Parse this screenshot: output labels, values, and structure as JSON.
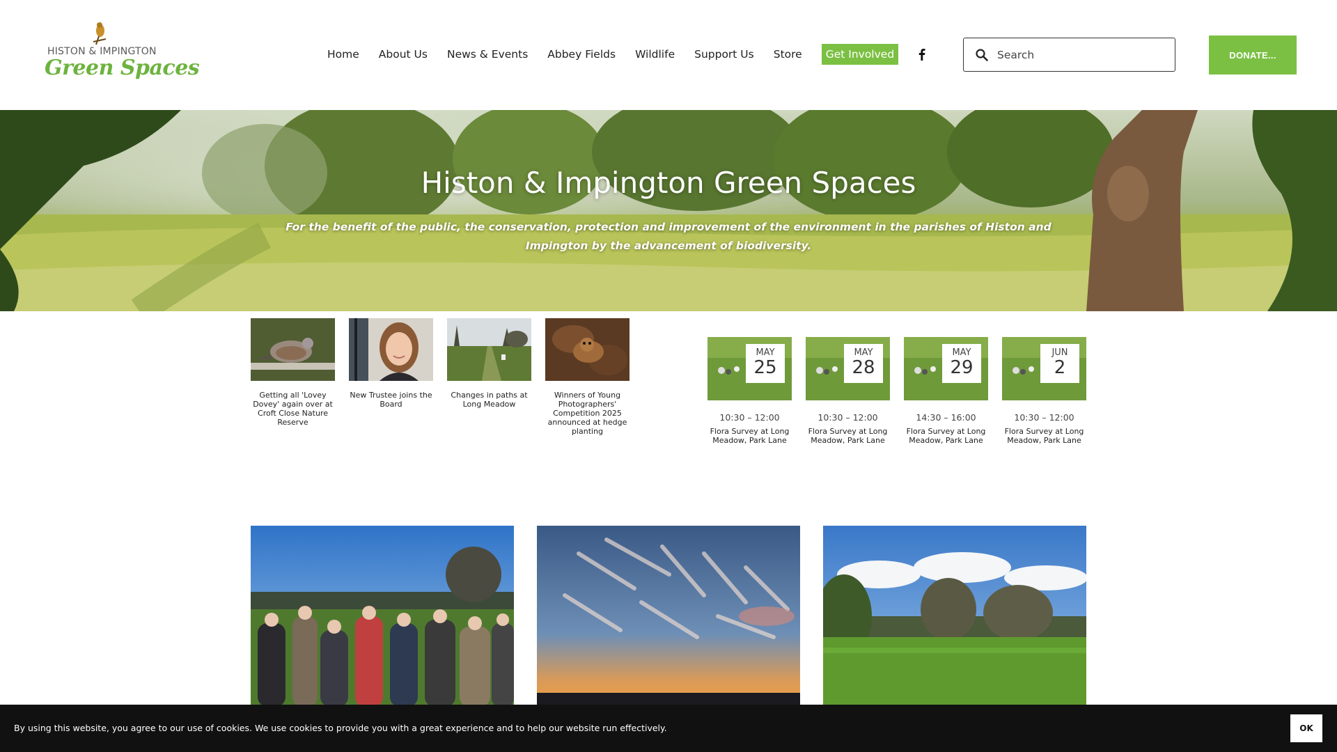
{
  "logo": {
    "top_text": "HISTON & IMPINGTON",
    "bottom_text": "Green Spaces"
  },
  "nav": {
    "items": [
      {
        "label": "Home"
      },
      {
        "label": "About Us"
      },
      {
        "label": "News & Events"
      },
      {
        "label": "Abbey Fields"
      },
      {
        "label": "Wildlife"
      },
      {
        "label": "Support Us"
      },
      {
        "label": "Store"
      },
      {
        "label": "Get Involved",
        "active": true
      }
    ]
  },
  "search": {
    "placeholder": "Search"
  },
  "donate": {
    "label": "DONATE..."
  },
  "hero": {
    "title": "Histon & Impington Green Spaces",
    "subtitle": "For the benefit of the public, the conservation, protection and improvement of the environment in the parishes of Histon and Impington by the advancement of biodiversity."
  },
  "news": [
    {
      "caption": "Getting all 'Lovey Dovey' again over at Croft Close Nature Reserve",
      "image": "turtle-dove"
    },
    {
      "caption": "New Trustee joins the Board",
      "image": "portrait"
    },
    {
      "caption": "Changes in paths at Long Meadow",
      "image": "meadow-path"
    },
    {
      "caption": "Winners of Young Photographers' Competition 2025 announced at hedge planting",
      "image": "fox"
    }
  ],
  "events": [
    {
      "month": "MAY",
      "day": "25",
      "time": "10:30 – 12:00",
      "title": "Flora Survey at Long Meadow, Park Lane"
    },
    {
      "month": "MAY",
      "day": "28",
      "time": "10:30 – 12:00",
      "title": "Flora Survey at Long Meadow, Park Lane"
    },
    {
      "month": "MAY",
      "day": "29",
      "time": "14:30 – 16:00",
      "title": "Flora Survey at Long Meadow, Park Lane"
    },
    {
      "month": "JUN",
      "day": "2",
      "time": "10:30 – 12:00",
      "title": "Flora Survey at Long Meadow, Park Lane"
    }
  ],
  "gallery": [
    "crowd-in-field",
    "sunset-sky",
    "trees-in-meadow"
  ],
  "cookie": {
    "text": "By using this website, you agree to our use of cookies. We use cookies to provide you with a great experience and to help our website run effectively.",
    "ok_label": "OK"
  },
  "colors": {
    "brand_green": "#7bc043",
    "logo_green": "#6db33f",
    "cookie_bg": "#111111"
  }
}
